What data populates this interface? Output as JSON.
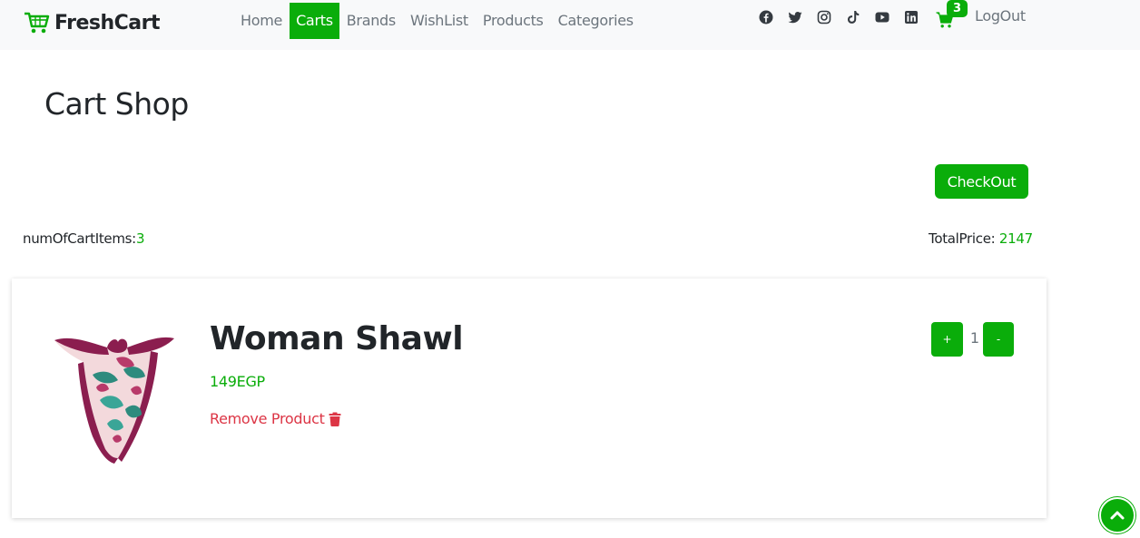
{
  "brand": {
    "name": "FreshCart",
    "icon": "cart-logo-icon",
    "accent": "#0aad0a"
  },
  "nav": {
    "links": [
      {
        "label": "Home",
        "active": false
      },
      {
        "label": "Carts",
        "active": true
      },
      {
        "label": "Brands",
        "active": false
      },
      {
        "label": "WishList",
        "active": false
      },
      {
        "label": "Products",
        "active": false
      },
      {
        "label": "Categories",
        "active": false
      }
    ],
    "social_icons": [
      "facebook-icon",
      "twitter-icon",
      "instagram-icon",
      "tiktok-icon",
      "youtube-icon",
      "linkedin-icon"
    ],
    "cart_count": "3",
    "logout_label": "LogOut"
  },
  "page": {
    "title": "Cart Shop",
    "checkout_label": "CheckOut",
    "num_items_label": "numOfCartItems:",
    "num_items_value": "3",
    "total_label": "TotalPrice: ",
    "total_value": "2147"
  },
  "cart_items": [
    {
      "title": "Woman Shawl",
      "price": "149EGP",
      "remove_label": "Remove Product",
      "plus_label": "+",
      "quantity": "1",
      "minus_label": "-"
    }
  ],
  "colors": {
    "accent": "#0aad0a",
    "danger": "#dc3545",
    "nav_bg": "#f8f9fa",
    "muted": "#6c757d"
  }
}
